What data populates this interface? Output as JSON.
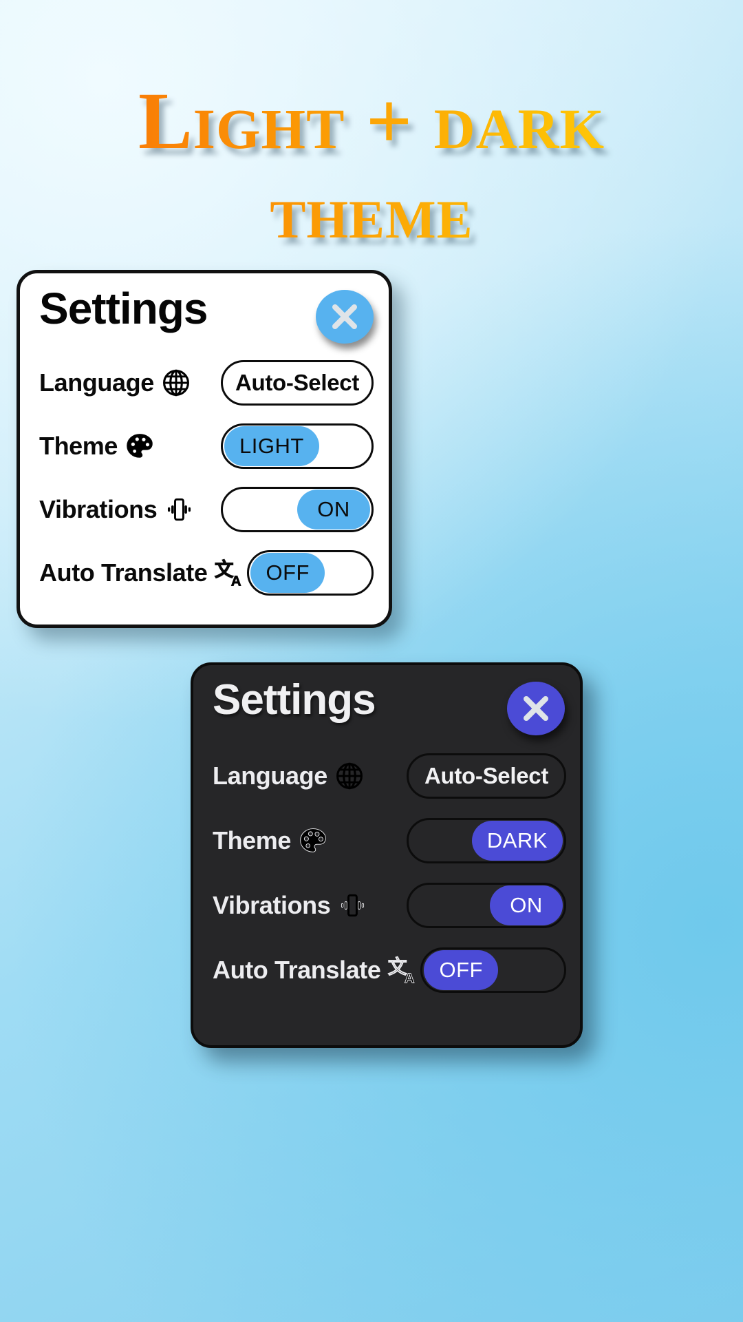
{
  "title": {
    "line1": "Light + dark",
    "line2": "theme",
    "gradient_start": "#f4620a",
    "gradient_end": "#ffd408"
  },
  "background": {
    "color_light": "#dff3fc",
    "color_deep": "#85cfee"
  },
  "light_card": {
    "name": "light-theme-settings-card",
    "title": "Settings",
    "close_icon": "close-icon",
    "accent_color": "#57b2ef",
    "surface_color": "#ffffff",
    "text_color": "#0a0a0a",
    "rows": [
      {
        "label": "Language",
        "icon": "globe-icon",
        "control_type": "value",
        "value": "Auto-Select",
        "pill_side": "none"
      },
      {
        "label": "Theme",
        "icon": "palette-icon",
        "control_type": "pill",
        "value": "LIGHT",
        "pill_side": "left"
      },
      {
        "label": "Vibrations",
        "icon": "vibration-icon",
        "control_type": "pill",
        "value": "ON",
        "pill_side": "right"
      },
      {
        "label": "Auto Translate",
        "icon": "translate-icon",
        "control_type": "pill",
        "value": "OFF",
        "pill_side": "left"
      }
    ]
  },
  "dark_card": {
    "name": "dark-theme-settings-card",
    "title": "Settings",
    "close_icon": "close-icon",
    "accent_color": "#4b4bd6",
    "surface_color": "#262628",
    "text_color": "#ededf0",
    "rows": [
      {
        "label": "Language",
        "icon": "globe-icon",
        "control_type": "value",
        "value": "Auto-Select",
        "pill_side": "none"
      },
      {
        "label": "Theme",
        "icon": "palette-icon",
        "control_type": "pill",
        "value": "DARK",
        "pill_side": "right"
      },
      {
        "label": "Vibrations",
        "icon": "vibration-icon",
        "control_type": "pill",
        "value": "ON",
        "pill_side": "right"
      },
      {
        "label": "Auto Translate",
        "icon": "translate-icon",
        "control_type": "pill",
        "value": "OFF",
        "pill_side": "left"
      }
    ]
  }
}
